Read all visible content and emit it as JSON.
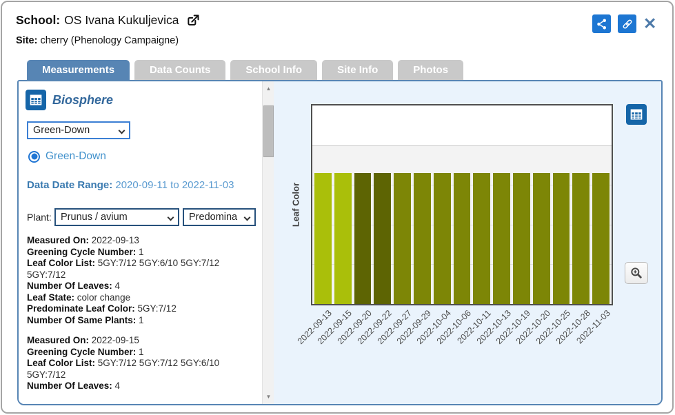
{
  "header": {
    "school_label": "School:",
    "school_name": "OS Ivana Kukuljevica",
    "site_label": "Site:",
    "site_value": "cherry (Phenology Campaigne)"
  },
  "icons": {
    "open_external": "external-link",
    "share": "share-nodes",
    "permalink": "link-chain",
    "close": "✕",
    "biosphere": "table",
    "chart_table": "table",
    "zoom": "magnifier-plus",
    "scroll_up": "▲",
    "scroll_down": "▼"
  },
  "tabs": [
    {
      "label": "Measurements",
      "active": true
    },
    {
      "label": "Data Counts",
      "active": false
    },
    {
      "label": "School Info",
      "active": false
    },
    {
      "label": "Site Info",
      "active": false
    },
    {
      "label": "Photos",
      "active": false
    }
  ],
  "sidebar": {
    "section_title": "Biosphere",
    "measure_select_value": "Green-Down",
    "radio_label": "Green-Down",
    "date_range_label": "Data Date Range:",
    "date_range_value": "2020-09-11 to 2022-11-03",
    "plant_label": "Plant:",
    "plant_select_value": "Prunus / avium",
    "predominate_select_value": "Predomina",
    "records": [
      {
        "fields": [
          {
            "label": "Measured On:",
            "value": "2022-09-13"
          },
          {
            "label": "Greening Cycle Number:",
            "value": "1"
          },
          {
            "label": "Leaf Color List:",
            "value": "5GY:7/12 5GY:6/10 5GY:7/12 5GY:7/12"
          },
          {
            "label": "Number Of Leaves:",
            "value": "4"
          },
          {
            "label": "Leaf State:",
            "value": "color change"
          },
          {
            "label": "Predominate Leaf Color:",
            "value": "5GY:7/12"
          },
          {
            "label": "Number Of Same Plants:",
            "value": "1"
          }
        ]
      },
      {
        "fields": [
          {
            "label": "Measured On:",
            "value": "2022-09-15"
          },
          {
            "label": "Greening Cycle Number:",
            "value": "1"
          },
          {
            "label": "Leaf Color List:",
            "value": "5GY:7/12 5GY:7/12 5GY:6/10 5GY:7/12"
          },
          {
            "label": "Number Of Leaves:",
            "value": "4"
          }
        ]
      }
    ]
  },
  "chart_data": {
    "type": "bar",
    "title": "",
    "ylabel": "Leaf Color",
    "xlabel": "",
    "categories": [
      "2022-09-13",
      "2022-09-15",
      "2022-09-20",
      "2022-09-22",
      "2022-09-27",
      "2022-09-29",
      "2022-10-04",
      "2022-10-06",
      "2022-10-11",
      "2022-10-13",
      "2022-10-19",
      "2022-10-20",
      "2022-10-25",
      "2022-10-28",
      "2022-11-03"
    ],
    "values": [
      1,
      1,
      1,
      1,
      1,
      1,
      1,
      1,
      1,
      1,
      1,
      1,
      1,
      1,
      1
    ],
    "bar_colors": [
      "#aabf0a",
      "#aabf0a",
      "#5d6403",
      "#5d6403",
      "#7d8606",
      "#7d8606",
      "#7d8606",
      "#7d8606",
      "#7d8606",
      "#7d8606",
      "#7d8606",
      "#7d8606",
      "#7d8606",
      "#7d8606",
      "#7d8606"
    ],
    "grid": true,
    "legend": false,
    "note": "Uniform-height bars; bar color encodes predominate leaf color (Munsell 5GY codes)."
  },
  "colors": {
    "accent_tab": "#5785b4",
    "inactive_tab": "#c9c9c9",
    "icon_button_blue": "#1d76d2",
    "table_icon_blue": "#1565a8",
    "link_text_blue": "#4191cc",
    "chart_panel_bg": "#eaf3fc",
    "bar_light": "#aabf0a",
    "bar_dark": "#5d6403",
    "bar_mid": "#7d8606"
  }
}
